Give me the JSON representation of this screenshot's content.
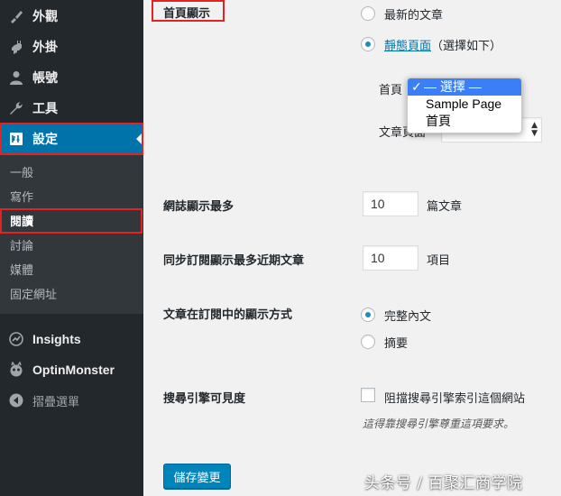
{
  "sidebar": {
    "items": [
      {
        "label": "外觀",
        "icon": "brush-icon"
      },
      {
        "label": "外掛",
        "icon": "plugin-icon"
      },
      {
        "label": "帳號",
        "icon": "user-icon"
      },
      {
        "label": "工具",
        "icon": "wrench-icon"
      },
      {
        "label": "設定",
        "icon": "settings-icon"
      }
    ],
    "submenu": [
      "一般",
      "寫作",
      "閱讀",
      "討論",
      "媒體",
      "固定網址"
    ],
    "extra": [
      {
        "label": "Insights",
        "icon": "insights-icon"
      },
      {
        "label": "OptinMonster",
        "icon": "optinmonster-icon"
      },
      {
        "label": "摺疊選單",
        "icon": "collapse-icon"
      }
    ]
  },
  "homepage": {
    "label": "首頁顯示",
    "option_latest": "最新的文章",
    "option_static": "靜態頁面",
    "option_static_hint": "（選擇如下）",
    "front_label": "首頁",
    "posts_label": "文章頁面",
    "dropdown_options": [
      "— 選擇 —",
      "Sample Page",
      "首頁"
    ]
  },
  "blog_pages": {
    "label": "網誌顯示最多",
    "value": "10",
    "unit": "篇文章"
  },
  "feed_posts": {
    "label": "同步訂閱顯示最多近期文章",
    "value": "10",
    "unit": "項目"
  },
  "feed_display": {
    "label": "文章在訂閱中的顯示方式",
    "option_full": "完整內文",
    "option_summary": "摘要"
  },
  "search_visibility": {
    "label": "搜尋引擎可見度",
    "checkbox_label": "阻擋搜尋引擎索引這個網站",
    "description": "這得靠搜尋引擎尊重這項要求。"
  },
  "save_button": "儲存變更",
  "watermark": "头条号 / 百聚汇商学院",
  "colors": {
    "accent": "#0073aa",
    "sidebar": "#23282d",
    "highlight": "#e52222"
  }
}
